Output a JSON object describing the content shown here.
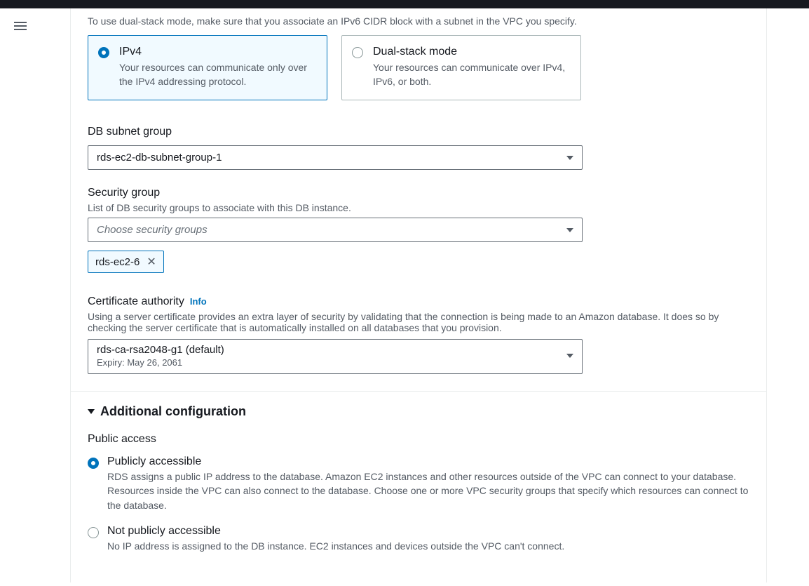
{
  "dualstack_help": "To use dual-stack mode, make sure that you associate an IPv6 CIDR block with a subnet in the VPC you specify.",
  "network_type": {
    "ipv4": {
      "title": "IPv4",
      "desc": "Your resources can communicate only over the IPv4 addressing protocol."
    },
    "dual": {
      "title": "Dual-stack mode",
      "desc": "Your resources can communicate over IPv4, IPv6, or both."
    }
  },
  "subnet": {
    "label": "DB subnet group",
    "value": "rds-ec2-db-subnet-group-1"
  },
  "security": {
    "label": "Security group",
    "help": "List of DB security groups to associate with this DB instance.",
    "placeholder": "Choose security groups",
    "chip": "rds-ec2-6"
  },
  "cert": {
    "label": "Certificate authority",
    "info": "Info",
    "help": "Using a server certificate provides an extra layer of security by validating that the connection is being made to an Amazon database. It does so by checking the server certificate that is automatically installed on all databases that you provision.",
    "value": "rds-ca-rsa2048-g1 (default)",
    "expiry": "Expiry: May 26, 2061"
  },
  "additional": {
    "header": "Additional configuration",
    "public_access_label": "Public access",
    "public": {
      "title": "Publicly accessible",
      "desc": "RDS assigns a public IP address to the database. Amazon EC2 instances and other resources outside of the VPC can connect to your database. Resources inside the VPC can also connect to the database. Choose one or more VPC security groups that specify which resources can connect to the database."
    },
    "not_public": {
      "title": "Not publicly accessible",
      "desc": "No IP address is assigned to the DB instance. EC2 instances and devices outside the VPC can't connect."
    }
  }
}
